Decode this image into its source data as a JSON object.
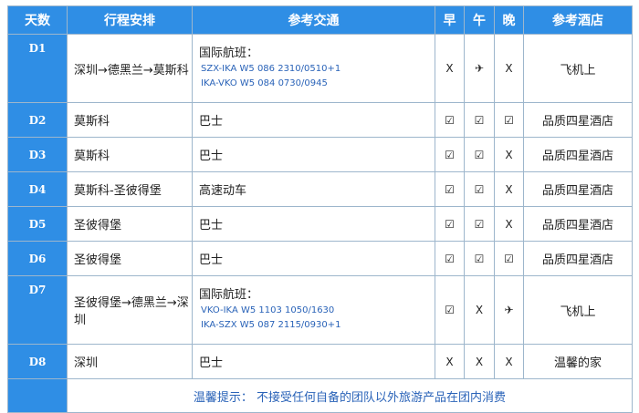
{
  "header": {
    "day": "天数",
    "plan": "行程安排",
    "transport": "参考交通",
    "breakfast": "早",
    "lunch": "午",
    "dinner": "晚",
    "hotel": "参考酒店"
  },
  "rows": [
    {
      "day": "D1",
      "plan": "深圳→德黑兰→莫斯科",
      "transport_title": "国际航班：",
      "flights": [
        "SZX-IKA W5 086  2310/0510+1",
        "IKA-VKO W5 084  0730/0945"
      ],
      "b": "X",
      "l": "✈",
      "d": "X",
      "hotel": "飞机上"
    },
    {
      "day": "D2",
      "plan": "莫斯科",
      "transport": "巴士",
      "b": "☑",
      "l": "☑",
      "d": "☑",
      "hotel": "品质四星酒店"
    },
    {
      "day": "D3",
      "plan": "莫斯科",
      "transport": "巴士",
      "b": "☑",
      "l": "☑",
      "d": "X",
      "hotel": "品质四星酒店"
    },
    {
      "day": "D4",
      "plan": "莫斯科-圣彼得堡",
      "transport": "高速动车",
      "b": "☑",
      "l": "☑",
      "d": "X",
      "hotel": "品质四星酒店"
    },
    {
      "day": "D5",
      "plan": "圣彼得堡",
      "transport": "巴士",
      "b": "☑",
      "l": "☑",
      "d": "X",
      "hotel": "品质四星酒店"
    },
    {
      "day": "D6",
      "plan": "圣彼得堡",
      "transport": "巴士",
      "b": "☑",
      "l": "☑",
      "d": "☑",
      "hotel": "品质四星酒店"
    },
    {
      "day": "D7",
      "plan": "圣彼得堡→德黑兰→深圳",
      "transport_title": "国际航班：",
      "flights": [
        "VKO-IKA W5 1103  1050/1630",
        "IKA-SZX W5 087  2115/0930+1"
      ],
      "b": "☑",
      "l": "X",
      "d": "✈",
      "hotel": "飞机上"
    },
    {
      "day": "D8",
      "plan": "深圳",
      "transport": "巴士",
      "b": "X",
      "l": "X",
      "d": "X",
      "hotel": "温馨的家"
    }
  ],
  "footer": "温馨提示： 不接受任何自备的团队以外旅游产品在团内消费"
}
